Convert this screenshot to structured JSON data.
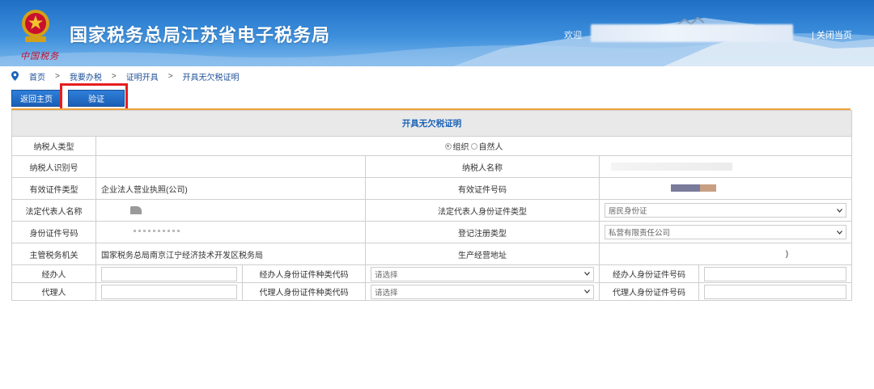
{
  "header": {
    "title": "国家税务总局江苏省电子税务局",
    "welcome": "欢迎",
    "close_link": "| 关闭当页",
    "brand_script": "中国税务"
  },
  "breadcrumb": {
    "items": [
      "首页",
      "我要办税",
      "证明开具",
      "开具无欠税证明"
    ],
    "separator": ">"
  },
  "toolbar": {
    "home_label": "返回主页",
    "verify_label": "验证"
  },
  "form": {
    "title": "开具无欠税证明",
    "taxpayer_type_label": "纳税人类型",
    "taxpayer_type_options": [
      "组织",
      "自然人"
    ],
    "taxpayer_type_selected": "组织",
    "taxpayer_id_label": "纳税人识别号",
    "taxpayer_name_label": "纳税人名称",
    "cert_type_label": "有效证件类型",
    "cert_type_value": "企业法人营业执照(公司)",
    "cert_no_label": "有效证件号码",
    "legal_rep_name_label": "法定代表人名称",
    "legal_rep_id_type_label": "法定代表人身份证件类型",
    "legal_rep_id_type_value": "居民身份证",
    "id_no_label": "身份证件号码",
    "reg_type_label": "登记注册类型",
    "reg_type_value": "私营有限责任公司",
    "tax_authority_label": "主管税务机关",
    "tax_authority_value": "国家税务总局南京江宁经济技术开发区税务局",
    "business_address_label": "生产经营地址",
    "business_address_tail": ")",
    "handler_label": "经办人",
    "handler_id_type_label": "经办人身份证件种类代码",
    "handler_id_type_value": "请选择",
    "handler_id_no_label": "经办人身份证件号码",
    "agent_label": "代理人",
    "agent_id_type_label": "代理人身份证件种类代码",
    "agent_id_type_value": "请选择",
    "agent_id_no_label": "代理人身份证件号码"
  },
  "colors": {
    "accent": "#1f6fc6",
    "highlight": "#e61e1e",
    "divider": "#f0a23a"
  }
}
